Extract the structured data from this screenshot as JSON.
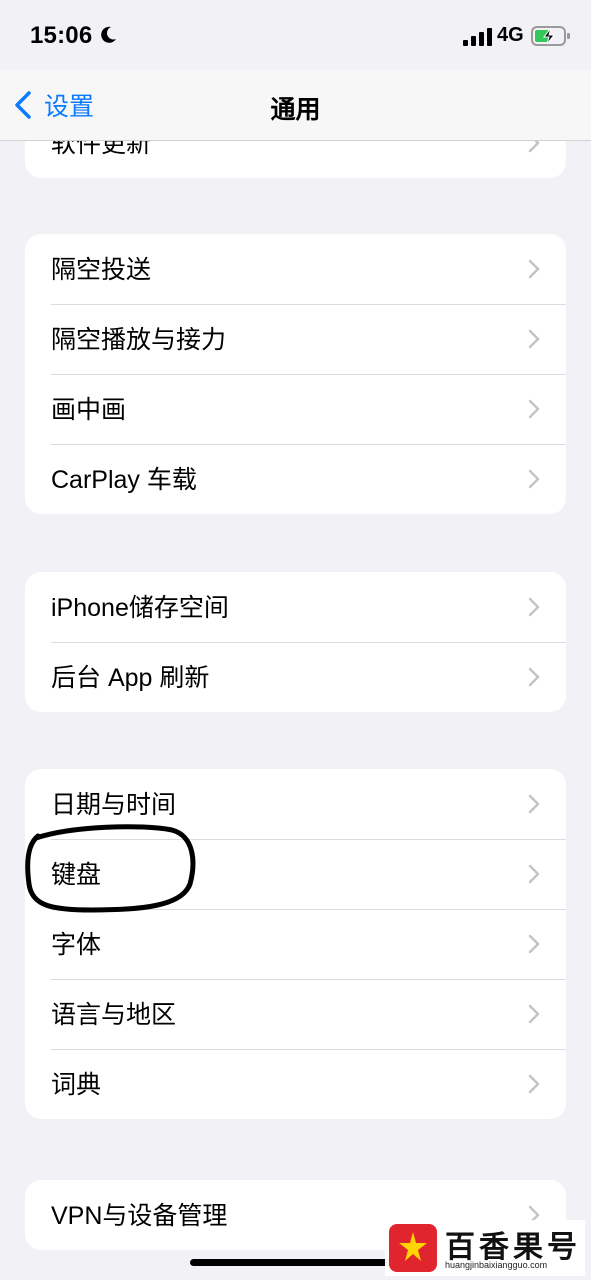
{
  "status_bar": {
    "time": "15:06",
    "network": "4G",
    "icons": [
      "moon-icon",
      "signal-icon",
      "battery-charging-icon"
    ]
  },
  "nav": {
    "back_label": "设置",
    "title": "通用"
  },
  "groups": [
    {
      "items": [
        "软件更新"
      ]
    },
    {
      "items": [
        "隔空投送",
        "隔空播放与接力",
        "画中画",
        "CarPlay 车载"
      ]
    },
    {
      "items": [
        "iPhone储存空间",
        "后台 App 刷新"
      ]
    },
    {
      "items": [
        "日期与时间",
        "键盘",
        "字体",
        "语言与地区",
        "词典"
      ]
    },
    {
      "items": [
        "VPN与设备管理"
      ]
    }
  ],
  "watermark": {
    "brand": "百香果号",
    "url": "huangjinbaixiangguo.com"
  },
  "colors": {
    "accent": "#0a7aff",
    "background": "#f2f2f6",
    "card": "#ffffff",
    "chevron": "#c4c4c7"
  }
}
